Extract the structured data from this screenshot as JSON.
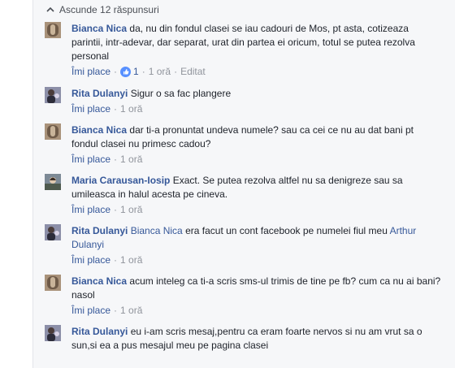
{
  "thread": {
    "hide_replies_label": "Ascunde 12 răspunsuri"
  },
  "comments": [
    {
      "author": "Bianca Nica",
      "text": "da, nu din fondul clasei se iau cadouri de Mos, pt asta, cotizeaza parintii, intr-adevar, dar separat, urat din partea ei oricum, totul se putea rezolva personal",
      "like_label": "Îmi place",
      "reaction_count": "1",
      "time": "1 oră",
      "edited": "Editat"
    },
    {
      "author": "Rita Dulanyi",
      "text": "Sigur o sa fac plangere",
      "like_label": "Îmi place",
      "time": "1 oră"
    },
    {
      "author": "Bianca Nica",
      "text": "dar ti-a pronuntat undeva numele? sau ca cei ce nu au dat bani pt fondul clasei nu primesc cadou?",
      "like_label": "Îmi place",
      "time": "1 oră"
    },
    {
      "author": "Maria Carausan-Iosip",
      "text": "Exact. Se putea rezolva altfel nu sa denigreze sau sa umileasca in halul acesta pe cineva.",
      "like_label": "Îmi place",
      "time": "1 oră"
    },
    {
      "author": "Rita Dulanyi",
      "tag": "Bianca Nica",
      "text": "era facut un cont facebook pe numelei fiul meu",
      "tag2": "Arthur Dulanyi",
      "like_label": "Îmi place",
      "time": "1 oră"
    },
    {
      "author": "Bianca Nica",
      "text": "acum inteleg ca ti-a scris sms-ul trimis de tine pe fb? cum ca nu ai bani? nasol",
      "like_label": "Îmi place",
      "time": "1 oră"
    },
    {
      "author": "Rita Dulanyi",
      "text": "eu i-am scris mesaj,pentru ca eram foarte nervos si nu am vrut sa o sun,si ea a pus mesajul meu pe pagina clasei"
    }
  ],
  "icons": {
    "chevron": "chevron-up-icon",
    "reaction": "thumbs-up-icon"
  },
  "colors": {
    "link": "#365899",
    "meta": "#90949c",
    "thread_bg": "#f6f7f9",
    "reaction_badge": "#5890ff"
  }
}
